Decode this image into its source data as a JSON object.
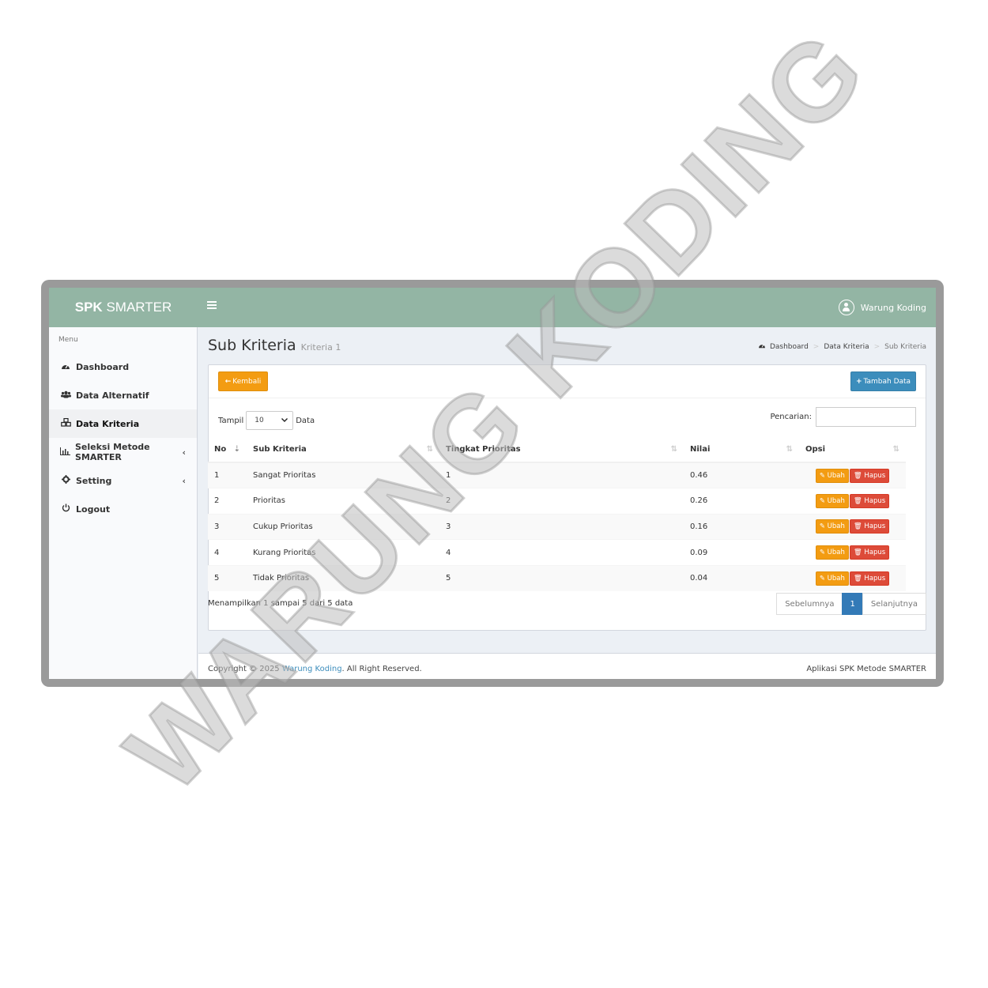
{
  "app": {
    "brand_bold": "SPK",
    "brand_rest": "SMARTER",
    "user": "Warung Koding"
  },
  "sidebar": {
    "header": "Menu",
    "items": [
      {
        "label": "Dashboard",
        "icon": "dashboard-icon"
      },
      {
        "label": "Data Alternatif",
        "icon": "users-icon"
      },
      {
        "label": "Data Kriteria",
        "icon": "cubes-icon"
      },
      {
        "label": "Seleksi Metode SMARTER",
        "icon": "bar-chart-icon"
      },
      {
        "label": "Setting",
        "icon": "gear-icon"
      },
      {
        "label": "Logout",
        "icon": "power-icon"
      }
    ]
  },
  "page": {
    "title": "Sub Kriteria",
    "subtitle": "Kriteria 1"
  },
  "breadcrumb": {
    "item1": "Dashboard",
    "item2": "Data Kriteria",
    "item3": "Sub Kriteria"
  },
  "box": {
    "back_label": "Kembali",
    "add_label": "Tambah Data",
    "show_prefix": "Tampil",
    "show_value": "10",
    "show_suffix": "Data",
    "search_label": "Pencarian:",
    "search_value": ""
  },
  "table": {
    "headers": [
      "No",
      "Sub Kriteria",
      "Tingkat Prioritas",
      "Nilai",
      "Opsi"
    ],
    "rows": [
      [
        "1",
        "Sangat Prioritas",
        "1",
        "0.46"
      ],
      [
        "2",
        "Prioritas",
        "2",
        "0.26"
      ],
      [
        "3",
        "Cukup Prioritas",
        "3",
        "0.16"
      ],
      [
        "4",
        "Kurang Prioritas",
        "4",
        "0.09"
      ],
      [
        "5",
        "Tidak Prioritas",
        "5",
        "0.04"
      ]
    ],
    "edit_label": "Ubah",
    "delete_label": "Hapus"
  },
  "pagination": {
    "info": "Menampilkan 1 sampai 5 dari 5 data",
    "prev": "Sebelumnya",
    "current": "1",
    "next": "Selanjutnya"
  },
  "footer": {
    "prefix": "Copyright © 2025",
    "link": "Warung Koding",
    "suffix": ". All Right Reserved.",
    "right": "Aplikasi SPK Metode SMARTER"
  },
  "watermark": "WARUNG KODING",
  "colors": {
    "topbar": "#93b5a4",
    "warning": "#f39c12",
    "danger": "#dd4b39",
    "primary": "#3c8dbc"
  }
}
